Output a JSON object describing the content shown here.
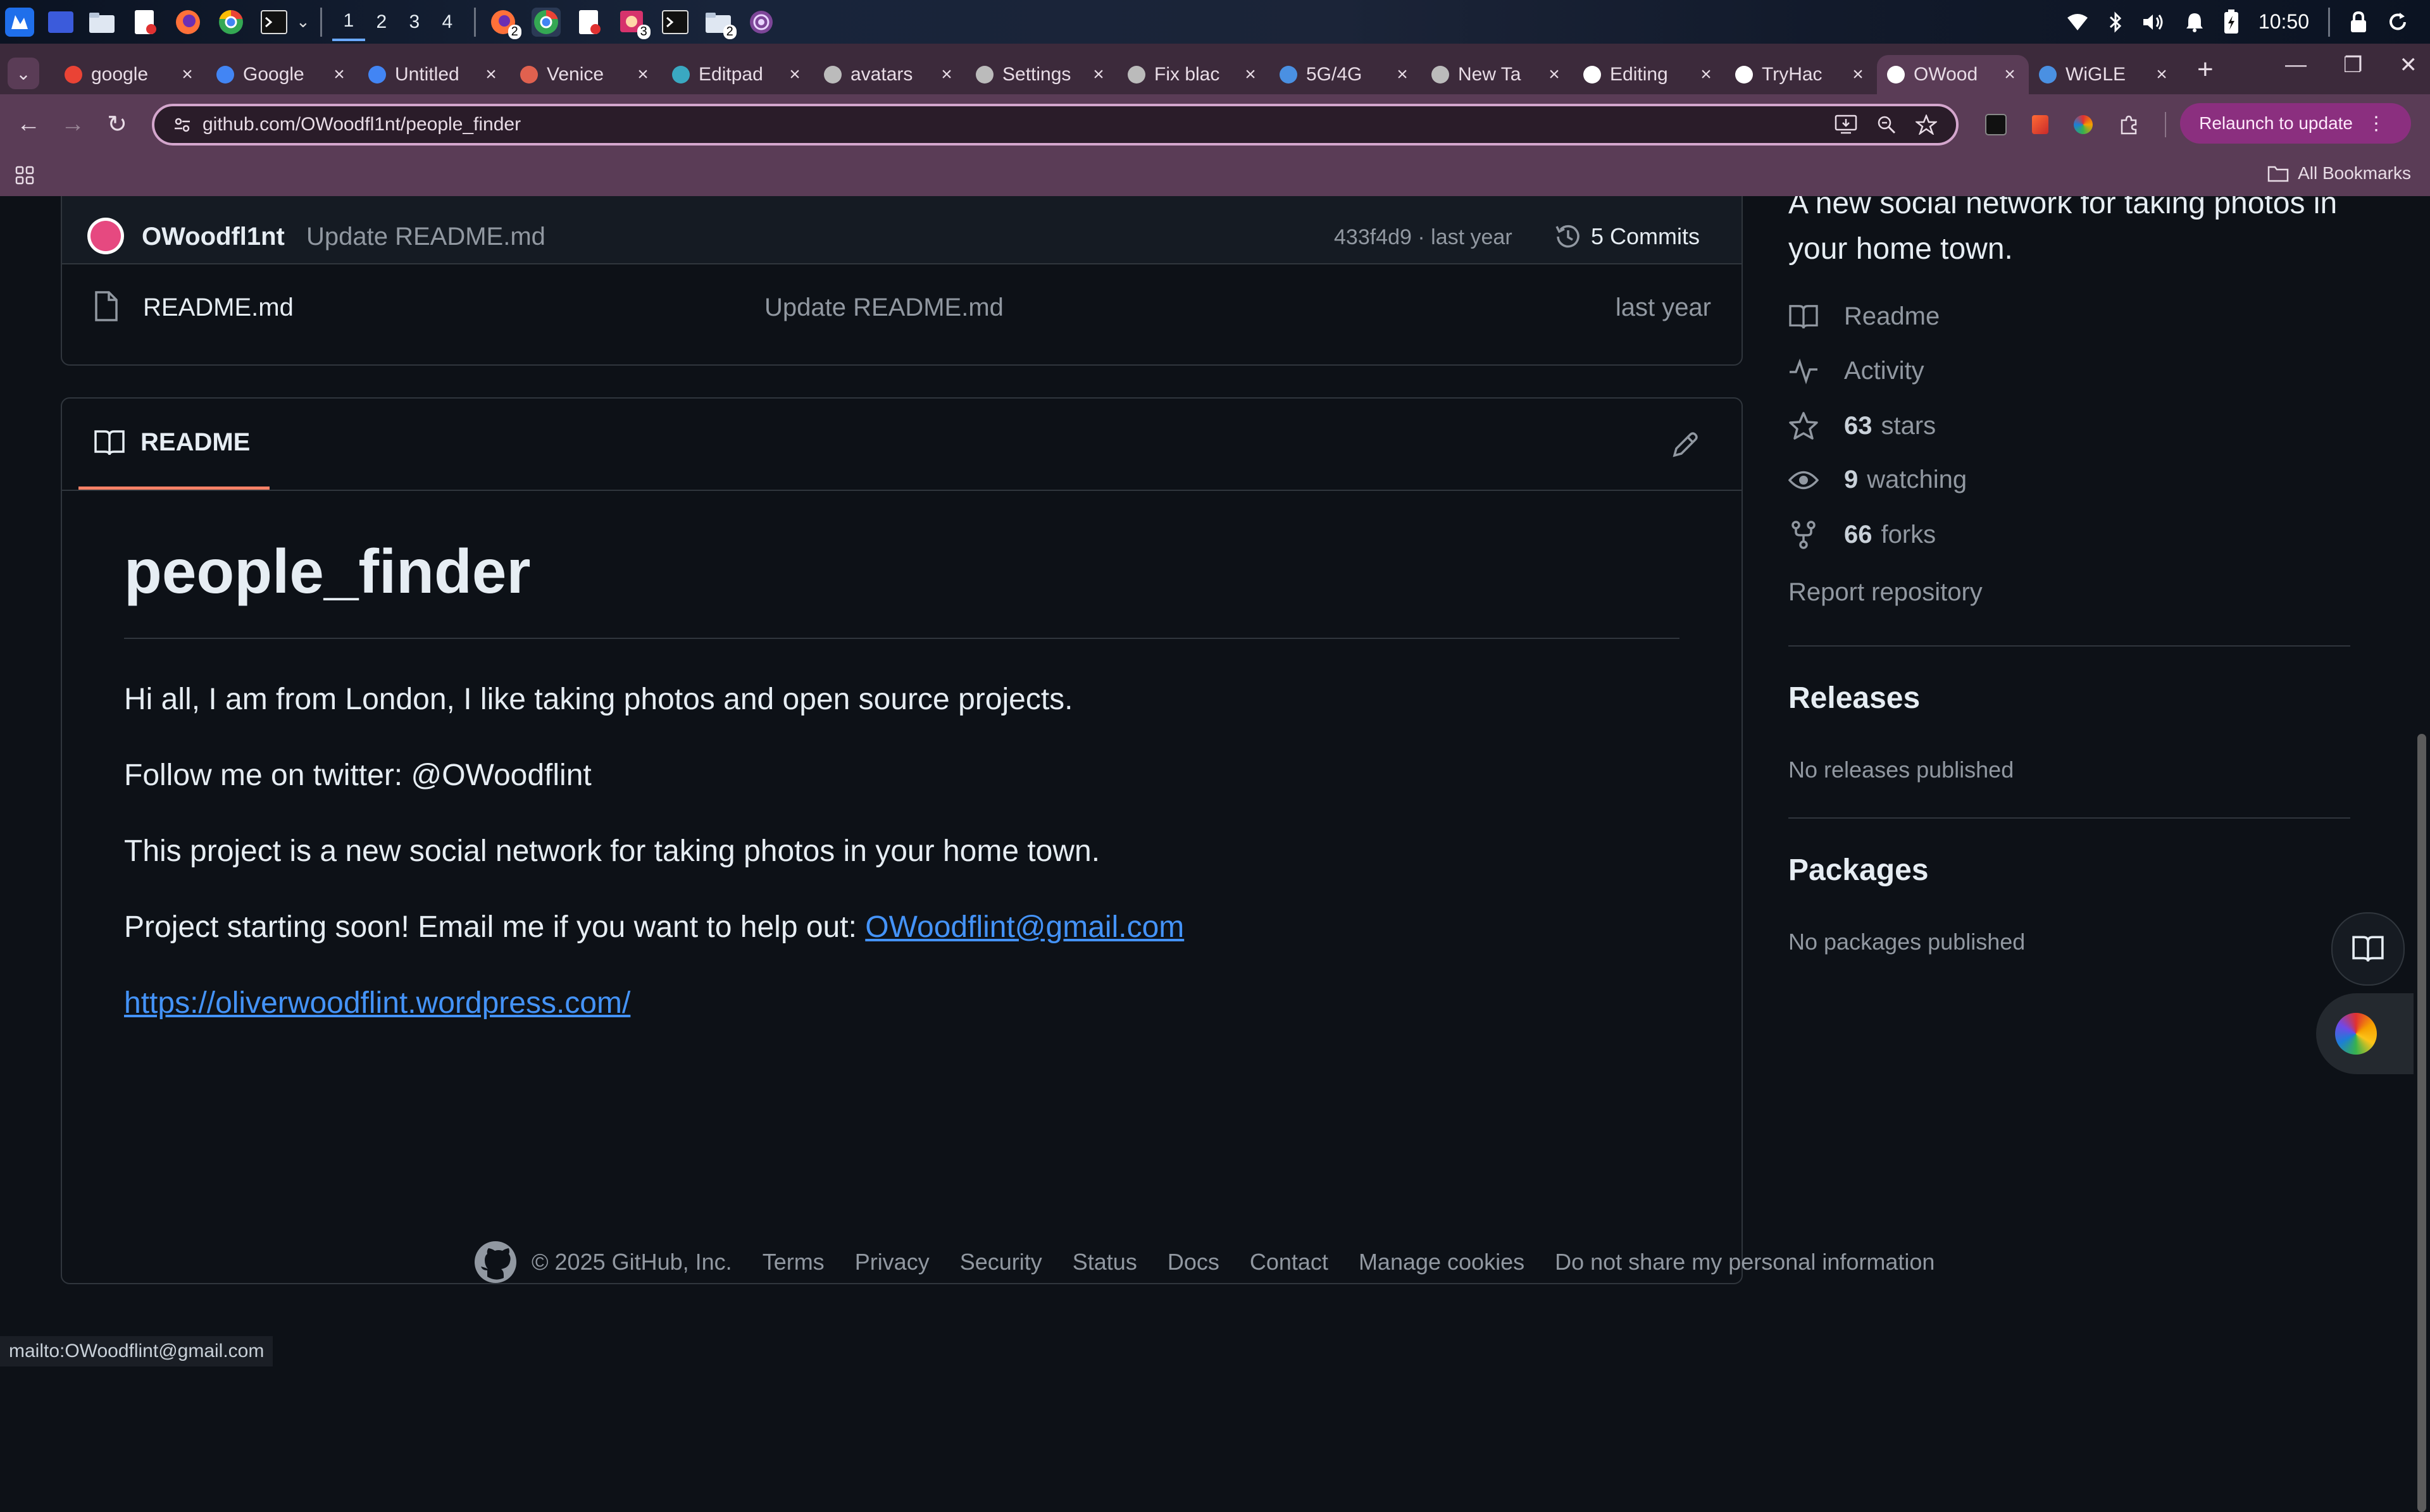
{
  "taskbar": {
    "workspaces": [
      "1",
      "2",
      "3",
      "4"
    ],
    "badges": [
      "2",
      "3",
      "2"
    ],
    "clock": "10:50"
  },
  "tabs": [
    {
      "label": "google",
      "icon": "gmail-icon",
      "color": "#ea4335"
    },
    {
      "label": "Google",
      "icon": "google-icon",
      "color": "#4285f4"
    },
    {
      "label": "Untitled",
      "icon": "docs-icon",
      "color": "#4285f4"
    },
    {
      "label": "Venice",
      "icon": "venice-icon",
      "color": "#e0614f"
    },
    {
      "label": "Editpad",
      "icon": "editpad-icon",
      "color": "#3aa8c1"
    },
    {
      "label": "avatars",
      "icon": "globe-icon",
      "color": "#bbbbbb"
    },
    {
      "label": "Settings",
      "icon": "gear-icon",
      "color": "#bbbbbb"
    },
    {
      "label": "Fix blac",
      "icon": "openai-icon",
      "color": "#bbbbbb"
    },
    {
      "label": "5G/4G",
      "icon": "link-icon",
      "color": "#4a90e2"
    },
    {
      "label": "New Ta",
      "icon": "chrome-icon",
      "color": "#bbbbbb"
    },
    {
      "label": "Editing",
      "icon": "github-icon",
      "color": "#ffffff"
    },
    {
      "label": "TryHac",
      "icon": "medium-icon",
      "color": "#ffffff"
    },
    {
      "label": "OWood",
      "icon": "github-icon",
      "color": "#ffffff",
      "active": true
    },
    {
      "label": "WiGLE",
      "icon": "wigle-icon",
      "color": "#4a90e2"
    }
  ],
  "toolbar": {
    "url": "github.com/OWoodfl1nt/people_finder",
    "relaunch": "Relaunch to update",
    "all_bookmarks": "All Bookmarks"
  },
  "commit_bar": {
    "author": "OWoodfl1nt",
    "message": "Update README.md",
    "hash": "433f4d9",
    "sep": "·",
    "when": "last year",
    "commits": "5 Commits"
  },
  "files": [
    {
      "name": "README.md",
      "message": "Update README.md",
      "when": "last year"
    }
  ],
  "readme": {
    "tab_label": "README",
    "heading": "people_finder",
    "p1": "Hi all, I am from London, I like taking photos and open source projects.",
    "p2": "Follow me on twitter: @OWoodflint",
    "p3": "This project is a new social network for taking photos in your home town.",
    "p4_text": "Project starting soon! Email me if you want to help out: ",
    "email": "OWoodflint@gmail.com",
    "site": "https://oliverwoodflint.wordpress.com/"
  },
  "sidebar": {
    "about_line1": "A new social network for taking photos in",
    "about_line2": "your home town.",
    "readme": "Readme",
    "activity": "Activity",
    "stars_count": "63",
    "stars_label": "stars",
    "watching_count": "9",
    "watching_label": "watching",
    "forks_count": "66",
    "forks_label": "forks",
    "report": "Report repository",
    "releases_title": "Releases",
    "releases_text": "No releases published",
    "packages_title": "Packages",
    "packages_text": "No packages published"
  },
  "footer": {
    "copyright": "© 2025 GitHub, Inc.",
    "links": [
      "Terms",
      "Privacy",
      "Security",
      "Status",
      "Docs",
      "Contact",
      "Manage cookies",
      "Do not share my personal information"
    ]
  },
  "status_bar": "mailto:OWoodflint@gmail.com"
}
